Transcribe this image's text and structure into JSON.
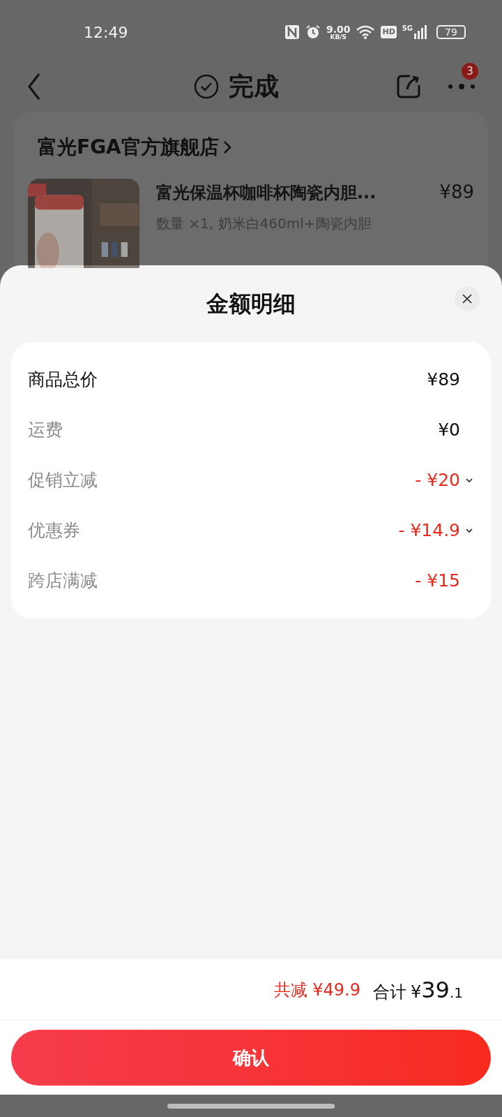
{
  "status_bar": {
    "time": "12:49",
    "speed": "9.00",
    "speed_unit": "KB/S",
    "hd": "HD",
    "network": "5G",
    "battery": "79"
  },
  "header": {
    "title": "完成",
    "badge": "3"
  },
  "store": {
    "name": "富光FGA官方旗舰店"
  },
  "product": {
    "title": "富光保温杯咖啡杯陶瓷内胆...",
    "price": "¥89",
    "spec": "数量 ×1, 奶米白460ml+陶瓷内胆"
  },
  "sheet": {
    "title": "金额明细",
    "rows": [
      {
        "kind": "total",
        "label": "商品总价",
        "value": "¥89"
      },
      {
        "kind": "fee",
        "label": "运费",
        "value": "¥0"
      },
      {
        "kind": "discount",
        "label": "促销立减",
        "value": "- ¥20",
        "expanded": false
      },
      {
        "kind": "discount",
        "label": "优惠券",
        "value": "- ¥14.9",
        "expanded": false
      },
      {
        "kind": "discount",
        "label": "跨店满减",
        "value": "- ¥15"
      }
    ]
  },
  "summary": {
    "saved": "共减 ¥49.9",
    "total_label": "合计",
    "currency": "¥",
    "total_integer": "39",
    "total_decimal": ".1"
  },
  "confirm_button": "确认"
}
